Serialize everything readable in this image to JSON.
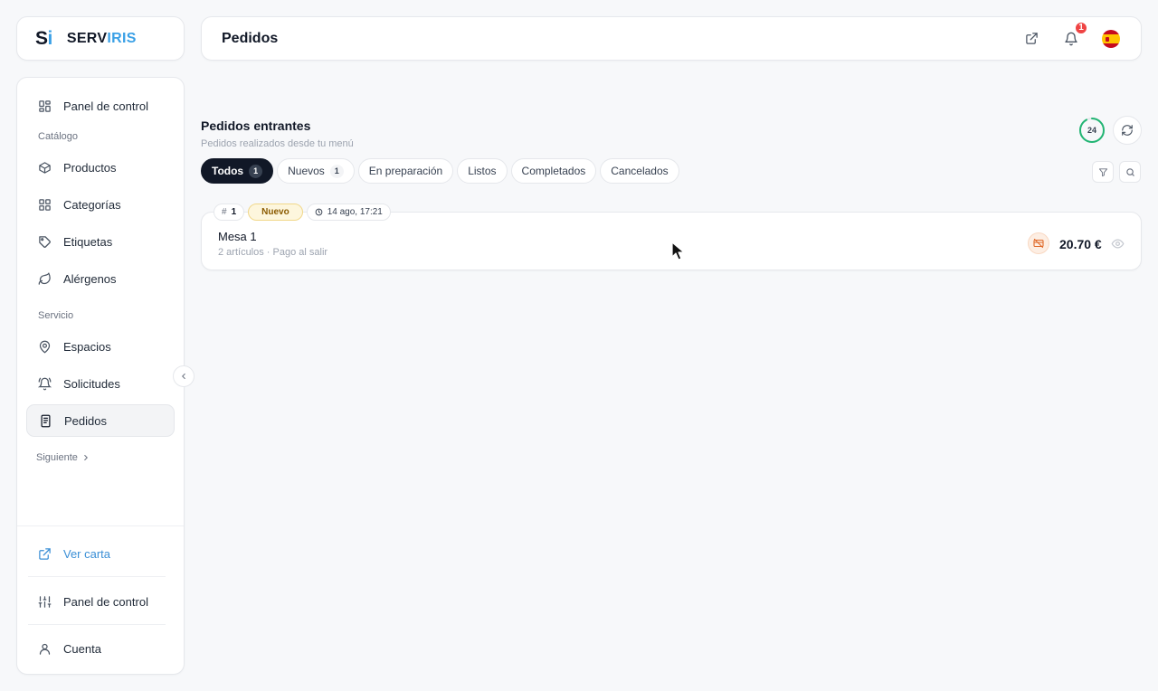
{
  "logo": {
    "mark_s": "S",
    "mark_i": "i",
    "name_a": "SERV",
    "name_b": "IRIS",
    "accent": "#3aa0e6"
  },
  "header": {
    "title": "Pedidos",
    "notifications_count": "1"
  },
  "sidebar": {
    "items": [
      {
        "label": "Panel de control",
        "icon": "dashboard-icon"
      },
      {
        "label": "Productos",
        "icon": "box-icon"
      },
      {
        "label": "Categorías",
        "icon": "grid-icon"
      },
      {
        "label": "Etiquetas",
        "icon": "tag-icon"
      },
      {
        "label": "Alérgenos",
        "icon": "leaf-icon"
      },
      {
        "label": "Espacios",
        "icon": "map-pin-icon"
      },
      {
        "label": "Solicitudes",
        "icon": "bell-icon"
      },
      {
        "label": "Pedidos",
        "icon": "receipt-icon"
      }
    ],
    "sections": {
      "catalog": "Catálogo",
      "service": "Servicio"
    },
    "next_label": "Siguiente",
    "footer": [
      {
        "label": "Ver carta",
        "icon": "external-link-icon"
      },
      {
        "label": "Panel de control",
        "icon": "sliders-icon"
      },
      {
        "label": "Cuenta",
        "icon": "user-icon"
      }
    ]
  },
  "main": {
    "title": "Pedidos entrantes",
    "subtitle": "Pedidos realizados desde tu menú",
    "counter": "24",
    "tabs": [
      {
        "label": "Todos",
        "count": "1"
      },
      {
        "label": "Nuevos",
        "count": "1"
      },
      {
        "label": "En preparación"
      },
      {
        "label": "Listos"
      },
      {
        "label": "Completados"
      },
      {
        "label": "Cancelados"
      }
    ]
  },
  "orders": [
    {
      "hash": "#",
      "number": "1",
      "status": "Nuevo",
      "time": "14 ago, 17:21",
      "title": "Mesa 1",
      "meta": "2 artículos · Pago al salir",
      "total": "20.70 €"
    }
  ],
  "colors": {
    "active_tab": "#111827",
    "status_new_bg": "#fdf6dd",
    "unpaid": "#e06a2a",
    "counter_ring": "#22b573"
  }
}
